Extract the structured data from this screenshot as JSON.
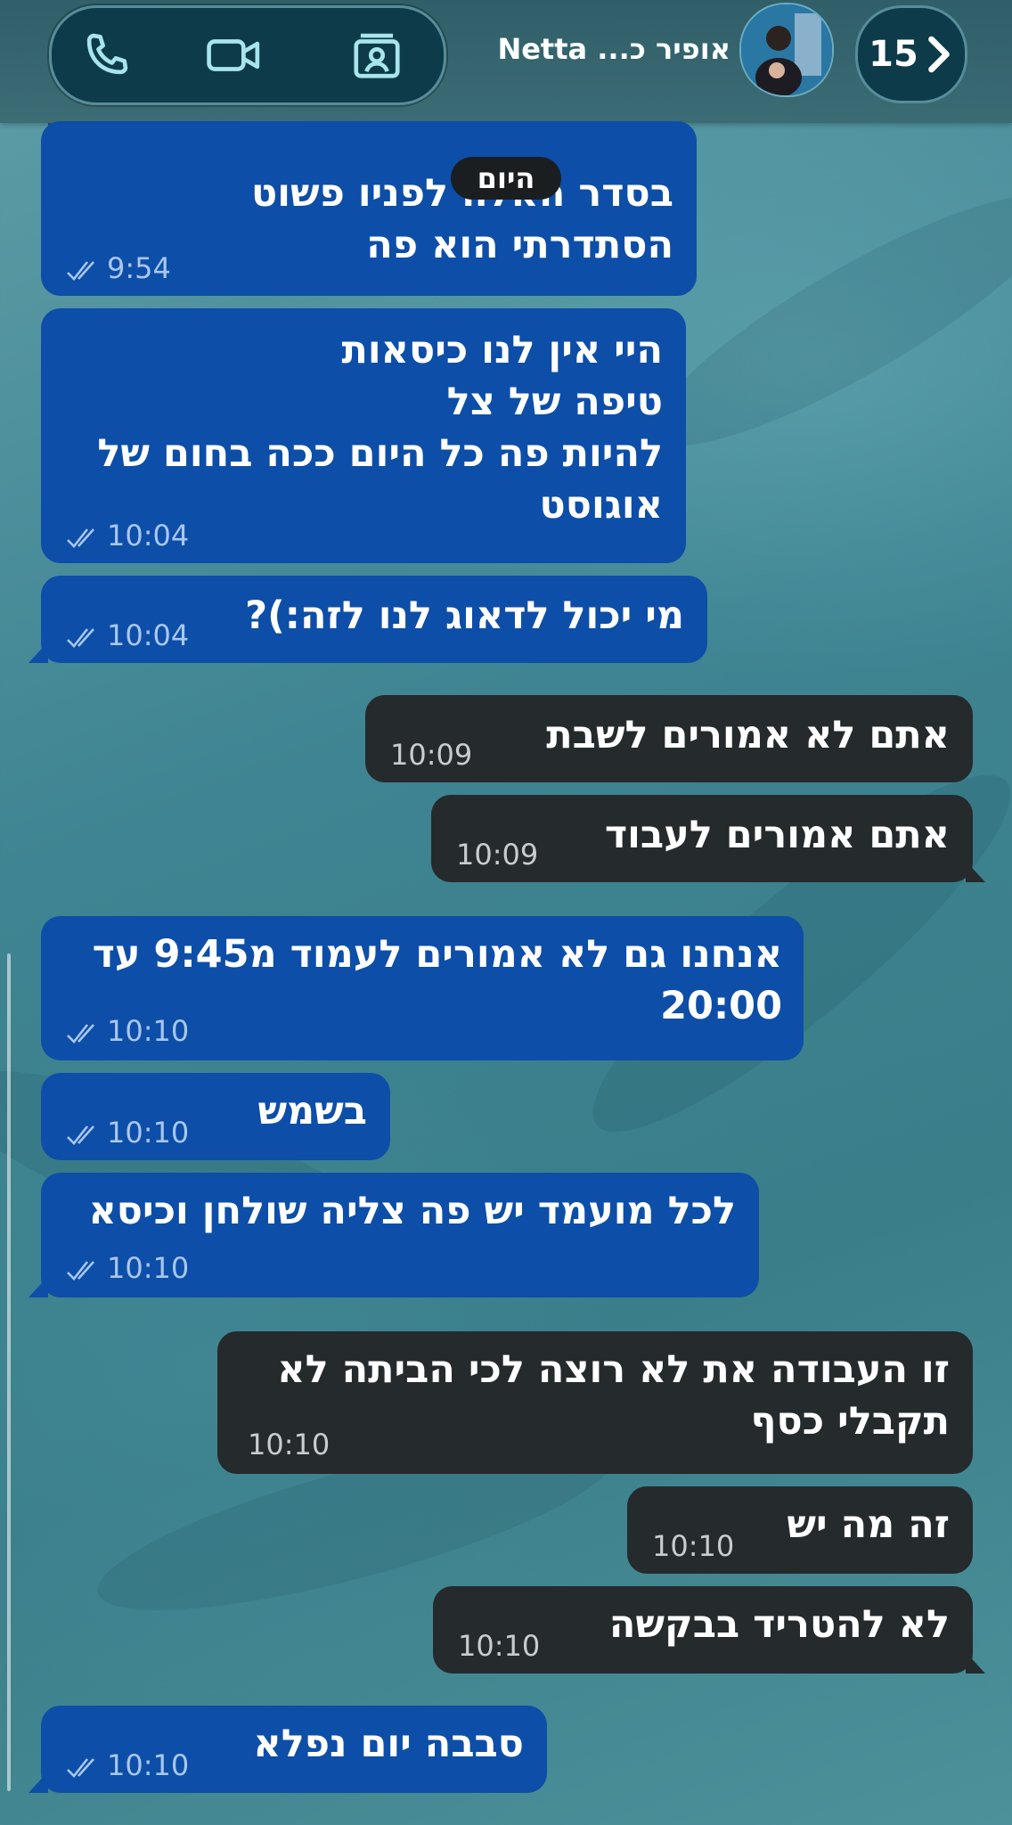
{
  "header": {
    "contact_name": "אופיר כ... Netta",
    "back_count": "15",
    "icons": [
      "phone-icon",
      "video-icon",
      "contact-card-icon",
      "chevron-right-icon"
    ]
  },
  "date_label": "היום",
  "messages": [
    {
      "side": "incoming",
      "text": "בסדר האלה לפניו פשוט\nהסתדרתי הוא פה",
      "time": "9:54"
    },
    {
      "side": "incoming",
      "text": "היי אין לנו כיסאות\nטיפה של צל\nלהיות פה כל היום ככה בחום של\nאוגוסט",
      "time": "10:04"
    },
    {
      "side": "incoming",
      "text": "מי יכול לדאוג לנו לזה:)?",
      "time": "10:04"
    },
    {
      "side": "outgoing",
      "text": "אתם לא אמורים לשבת",
      "time": "10:09"
    },
    {
      "side": "outgoing",
      "text": "אתם אמורים לעבוד",
      "time": "10:09"
    },
    {
      "side": "incoming",
      "text": "אנחנו גם לא אמורים לעמוד מ9:45 עד\n20:00",
      "time": "10:10"
    },
    {
      "side": "incoming",
      "text": "בשמש",
      "time": "10:10"
    },
    {
      "side": "incoming",
      "text": "לכל מועמד יש פה צליה שולחן וכיסא",
      "time": "10:10"
    },
    {
      "side": "outgoing",
      "text": "זו העבודה את לא רוצה לכי הביתה לא\nתקבלי כסף",
      "time": "10:10"
    },
    {
      "side": "outgoing",
      "text": "זה מה יש",
      "time": "10:10"
    },
    {
      "side": "outgoing",
      "text": "לא להטריד בבקשה",
      "time": "10:10"
    },
    {
      "side": "incoming",
      "text": "סבבה יום נפלא",
      "time": "10:10"
    }
  ],
  "colors": {
    "incoming_bubble": "#0d4ea8",
    "outgoing_bubble": "#252a2d",
    "header_pill": "#0d3b49"
  }
}
